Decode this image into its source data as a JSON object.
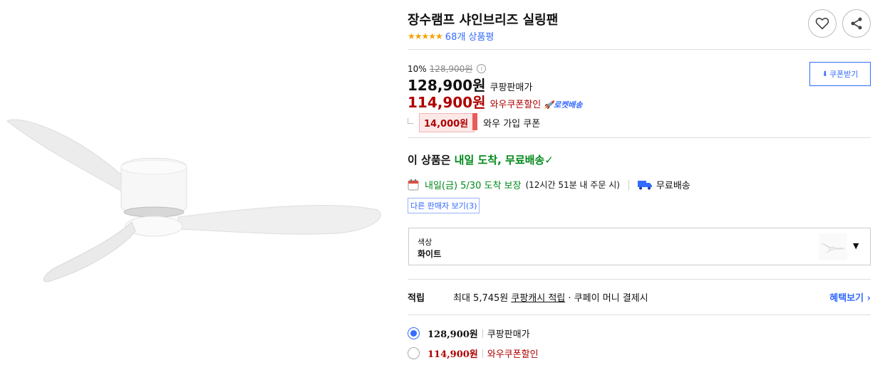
{
  "product": {
    "title": "장수램프 샤인브리즈 실링팬",
    "stars": "★★★★★",
    "review_count": "68개 상품평"
  },
  "pricing": {
    "discount_rate": "10%",
    "original_price": "128,900원",
    "info_icon": "i",
    "sale_price": "128,900원",
    "sale_label": "쿠팡판매가",
    "wow_price": "114,900원",
    "wow_label": "와우쿠폰할인",
    "rocket_label": "🚀로켓배송",
    "coupon_amount": "14,000원",
    "coupon_desc": "와우 가입 쿠폰",
    "coupon_download_label": "쿠폰받기"
  },
  "delivery": {
    "headline_prefix": "이 상품은",
    "headline_highlight": "내일 도착, 무료배송",
    "check": "✓",
    "date_text": "내일(금) 5/30 도착 보장",
    "date_note": "(12시간 51분 내 주문 시)",
    "free_shipping": "무료배송",
    "other_sellers": "다른 판매자 보기(3)"
  },
  "option": {
    "label": "색상",
    "value": "화이트",
    "caret": "▼"
  },
  "points": {
    "label": "적립",
    "prefix": "최대 5,745원",
    "link": "쿠팡캐시 적립",
    "suffix": "· 쿠페이 머니 결제시",
    "benefit_link": "혜택보기 ›"
  },
  "price_options": [
    {
      "price": "128,900원",
      "label": "쿠팡판매가",
      "selected": true
    },
    {
      "price": "114,900원",
      "label": "와우쿠폰할인",
      "selected": false
    }
  ],
  "icons": {
    "heart": "heart-icon",
    "share": "share-icon",
    "calendar": "calendar-icon",
    "truck": "truck-icon",
    "download": "download-icon"
  },
  "colors": {
    "accent_blue": "#346aff",
    "wow_red": "#ae0000",
    "delivery_green": "#00891a",
    "star_orange": "#f5a300"
  }
}
